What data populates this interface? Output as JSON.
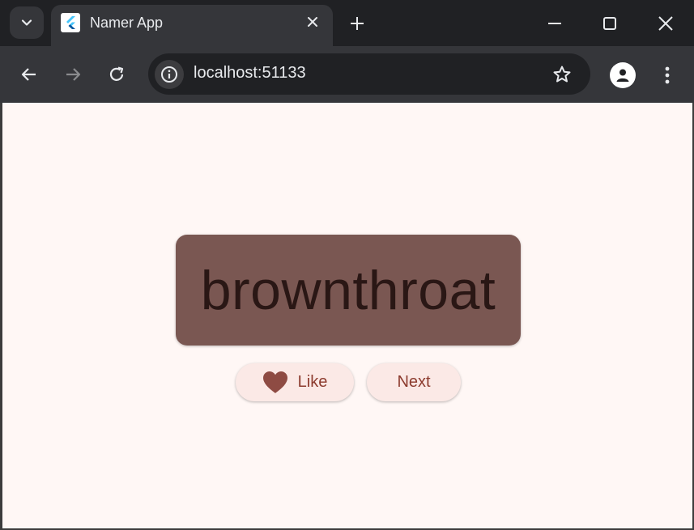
{
  "browser": {
    "tab": {
      "title": "Namer App",
      "favicon": "flutter-logo"
    },
    "address": {
      "url": "localhost:51133"
    },
    "icons": [
      "tab-search-icon",
      "close-icon",
      "plus-icon",
      "minimize-icon",
      "maximize-icon",
      "window-close-icon",
      "back-arrow-icon",
      "forward-arrow-icon",
      "reload-icon",
      "info-icon",
      "star-icon",
      "account-icon",
      "more-vert-icon"
    ]
  },
  "app": {
    "word": "brownthroat",
    "buttons": {
      "like_label": "Like",
      "next_label": "Next"
    },
    "colors": {
      "background": "#fff7f5",
      "card": "#7a5752",
      "word_text": "#2a1715",
      "button_bg": "#fbe9e6",
      "accent": "#8c3b2e",
      "heart": "#8e4b43"
    }
  }
}
